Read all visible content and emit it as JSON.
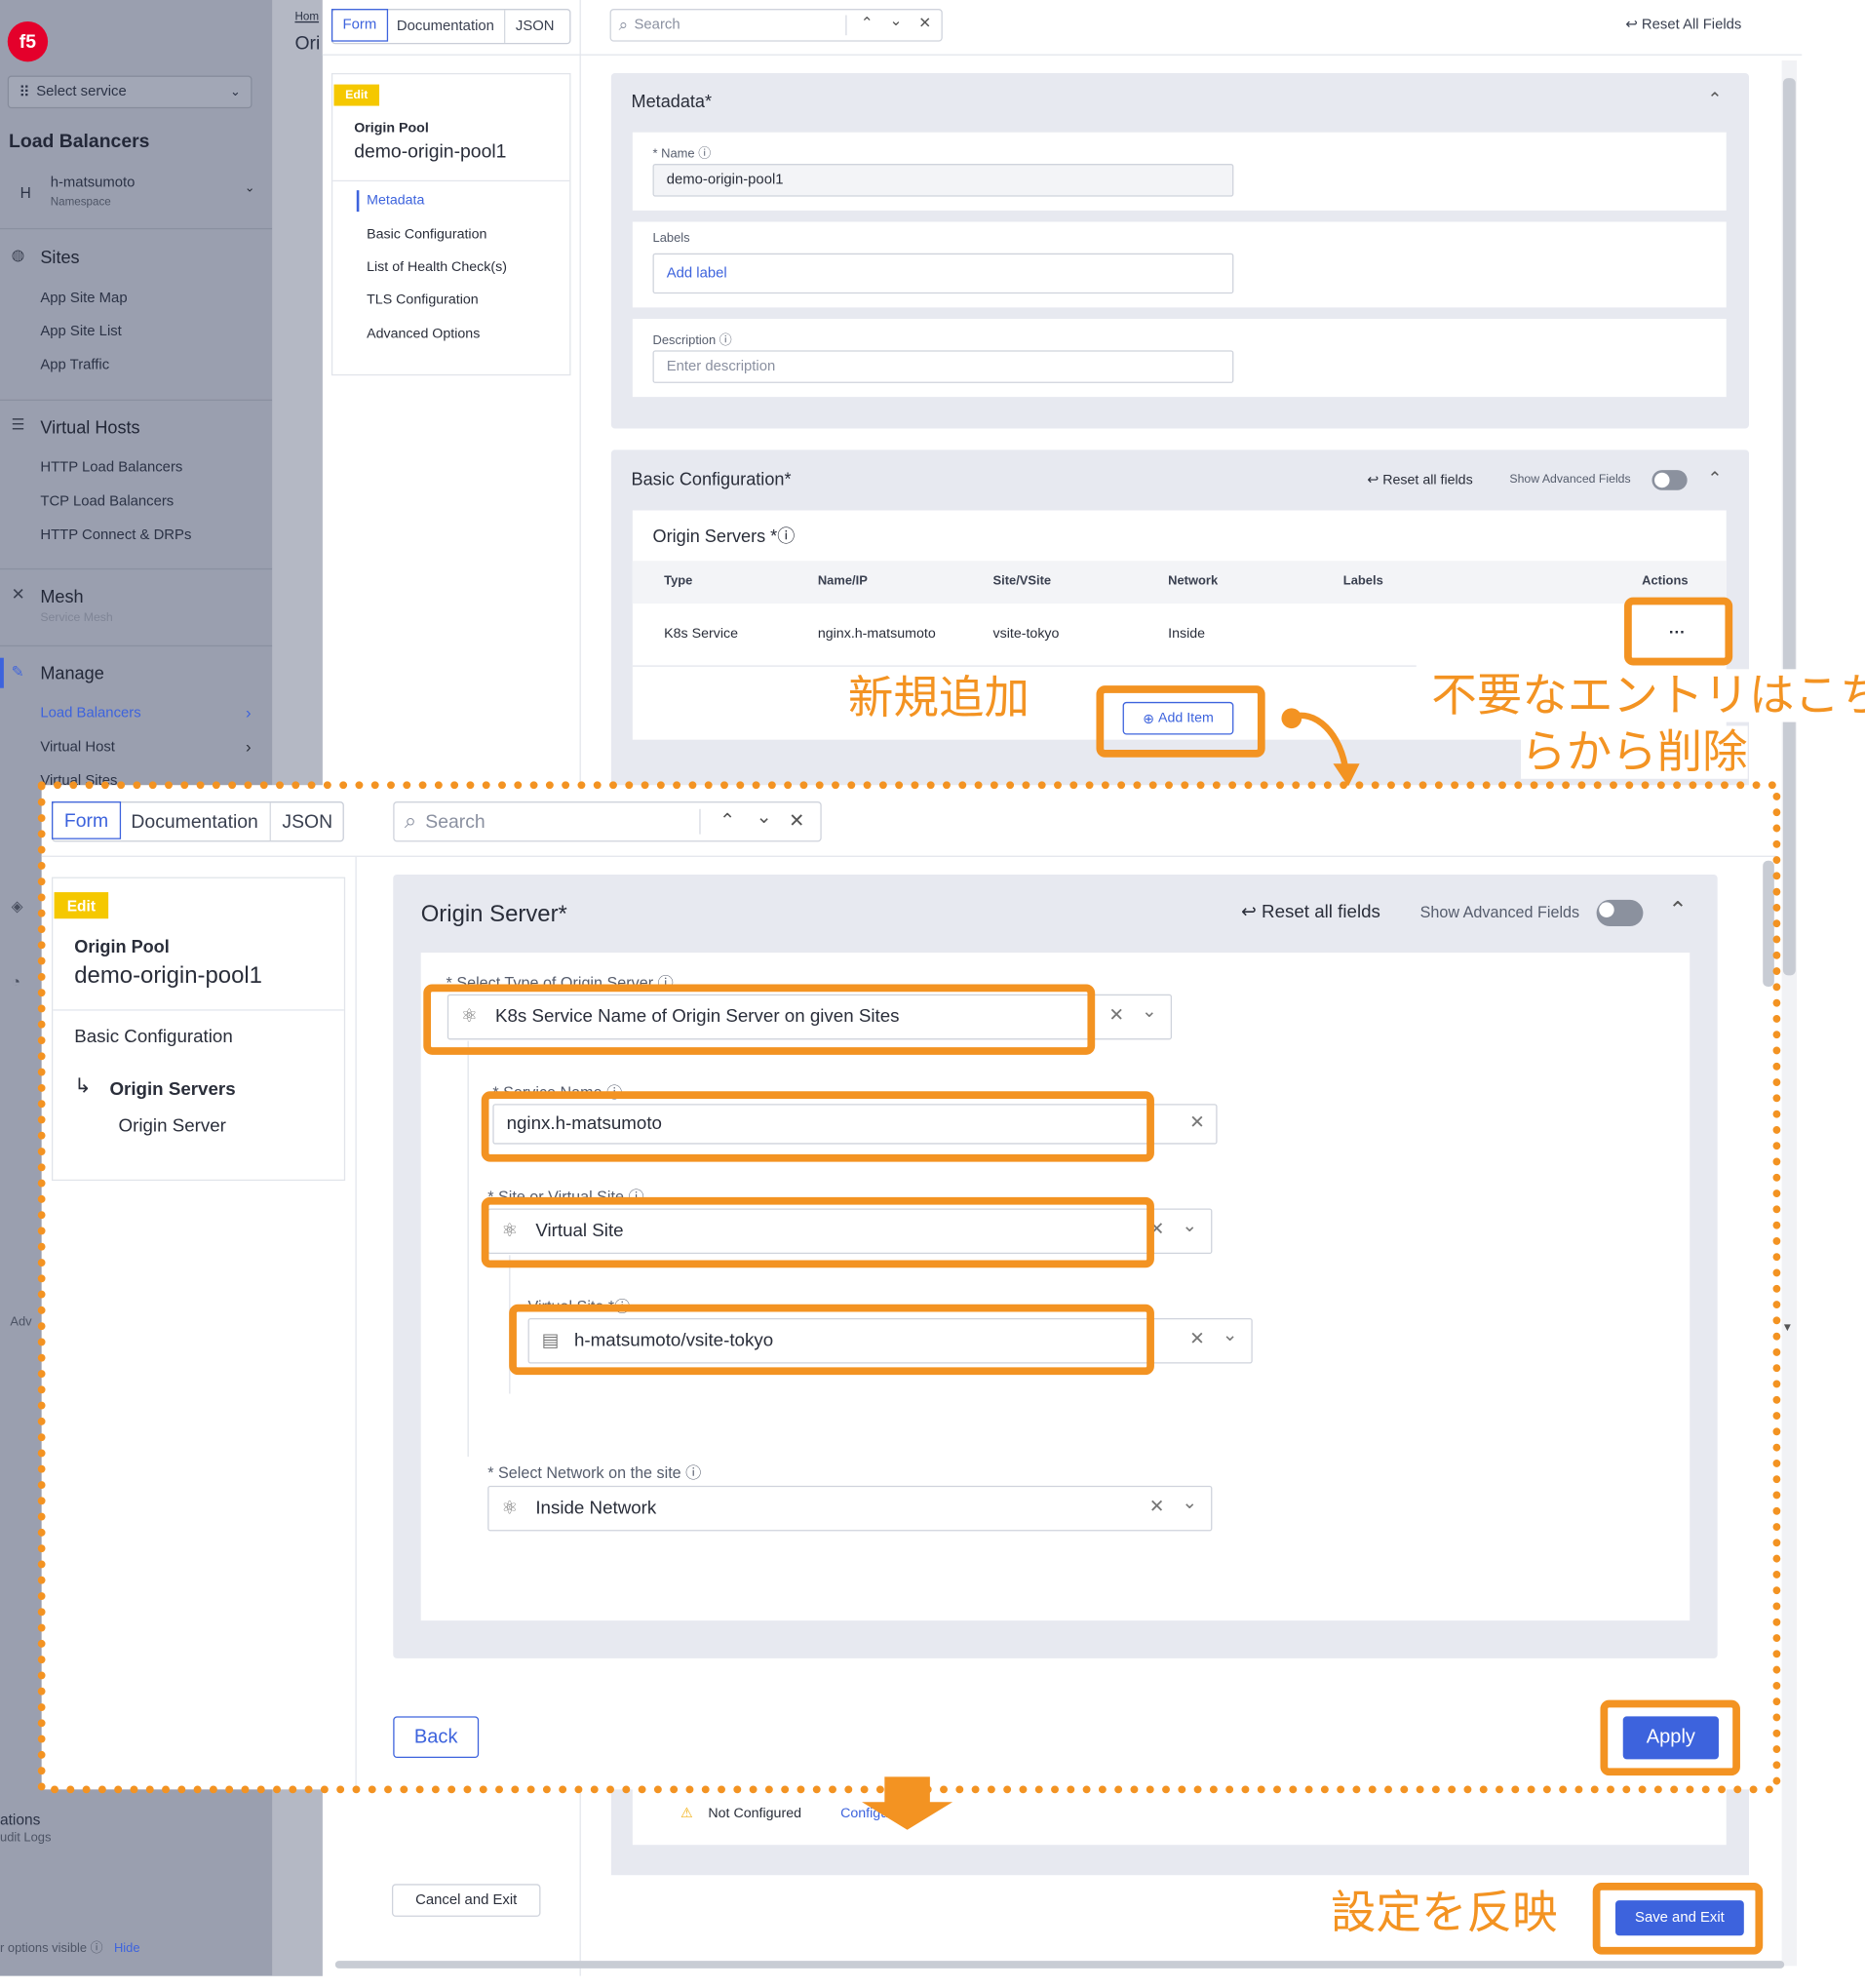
{
  "sidebar": {
    "select_service": "Select service",
    "workspace_title": "Load Balancers",
    "namespace_initial": "H",
    "namespace_name": "h-matsumoto",
    "namespace_label": "Namespace",
    "sections": {
      "sites": {
        "title": "Sites",
        "items": [
          "App Site Map",
          "App Site List",
          "App Traffic"
        ]
      },
      "virtual_hosts": {
        "title": "Virtual Hosts",
        "items": [
          "HTTP Load Balancers",
          "TCP Load Balancers",
          "HTTP Connect & DRPs"
        ]
      },
      "mesh": {
        "title": "Mesh",
        "subtitle": "Service Mesh"
      },
      "manage": {
        "title": "Manage",
        "items": [
          "Load Balancers",
          "Virtual Host",
          "Virtual Sites"
        ]
      }
    },
    "partial_adv": "Adv",
    "partial_ations": "ations",
    "partial_audit": "udit Logs",
    "footer_options": "r options visible",
    "footer_hide": "Hide"
  },
  "breadcrumb": {
    "home": "Hom",
    "page": "Ori"
  },
  "editor": {
    "tabs": [
      "Form",
      "Documentation",
      "JSON"
    ],
    "search_placeholder": "Search",
    "reset_all_fields": "Reset All Fields",
    "badge": "Edit",
    "object_type": "Origin Pool",
    "object_name": "demo-origin-pool1",
    "toc": [
      "Metadata",
      "Basic Configuration",
      "List of Health Check(s)",
      "TLS Configuration",
      "Advanced Options"
    ],
    "metadata": {
      "title": "Metadata",
      "name_label": "Name",
      "name_value": "demo-origin-pool1",
      "labels_label": "Labels",
      "add_label": "Add label",
      "description_label": "Description",
      "description_placeholder": "Enter description"
    },
    "basic": {
      "title": "Basic Configuration",
      "reset": "Reset all fields",
      "show_advanced": "Show Advanced Fields",
      "origin_servers": "Origin Servers",
      "columns": [
        "Type",
        "Name/IP",
        "Site/VSite",
        "Network",
        "Labels",
        "Actions"
      ],
      "row": {
        "type": "K8s Service",
        "name": "nginx.h-matsumoto",
        "site": "vsite-tokyo",
        "network": "Inside"
      },
      "actions_icon": "···",
      "add_item": "Add Item"
    },
    "lower": {
      "not_configured": "Not Configured",
      "configure": "Configu"
    },
    "cancel_and_exit": "Cancel and Exit",
    "save_and_exit": "Save and Exit"
  },
  "overlay": {
    "tabs": [
      "Form",
      "Documentation",
      "JSON"
    ],
    "search_placeholder": "Search",
    "badge": "Edit",
    "object_type": "Origin Pool",
    "object_name": "demo-origin-pool1",
    "nav": {
      "basic": "Basic Configuration",
      "origin_servers": "Origin Servers",
      "origin_server": "Origin Server"
    },
    "title": "Origin Server",
    "reset": "Reset all fields",
    "show_advanced": "Show Advanced Fields",
    "select_type_label": "Select Type of Origin Server",
    "select_type_value": "K8s Service Name of Origin Server on given Sites",
    "service_name_label": "Service Name",
    "service_name_value": "nginx.h-matsumoto",
    "site_label": "Site or Virtual Site",
    "site_value": "Virtual Site",
    "vsite_label": "Virtual Site",
    "vsite_value": "h-matsumoto/vsite-tokyo",
    "network_label": "Select Network on the site",
    "network_value": "Inside Network",
    "back": "Back",
    "apply": "Apply"
  },
  "annotations": {
    "add_new": "新規追加",
    "delete_line1": "不要なエントリはこち",
    "delete_line2": "らから削除",
    "apply_reflect": "設定を反映"
  },
  "colors": {
    "accent": "#3d63dd",
    "annotation": "#f39322",
    "badge": "#f5c800"
  }
}
